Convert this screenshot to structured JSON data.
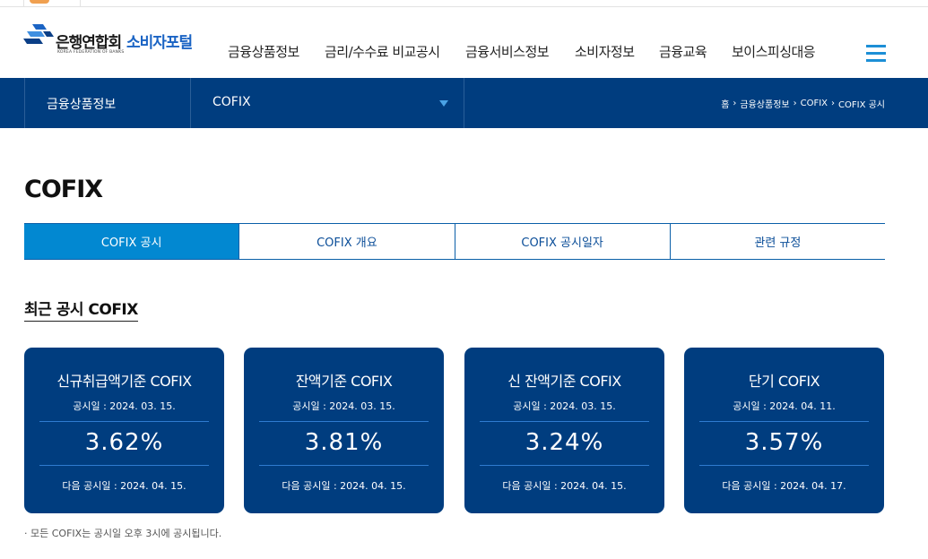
{
  "logo": {
    "name": "은행연합회",
    "english": "KOREA FEDERATION OF BANKS",
    "portal": "소비자포털"
  },
  "nav": {
    "items": [
      "금융상품정보",
      "금리/수수료 비교공시",
      "금융서비스정보",
      "소비자정보",
      "금융교육",
      "보이스피싱대응"
    ]
  },
  "subbar": {
    "depth1": "금융상품정보",
    "depth2": "COFIX",
    "breadcrumb": [
      "홈",
      "금융상품정보",
      "COFIX",
      "COFIX 공시"
    ]
  },
  "page": {
    "title": "COFIX",
    "section_title": "최근 공시 COFIX",
    "footnote": "· 모든 COFIX는 공시일 오후 3시에 공시됩니다."
  },
  "tabs": [
    {
      "label": "COFIX 공시",
      "active": true
    },
    {
      "label": "COFIX 개요",
      "active": false
    },
    {
      "label": "COFIX 공시일자",
      "active": false
    },
    {
      "label": "관련 규정",
      "active": false
    }
  ],
  "cards": [
    {
      "name": "신규취급액기준 COFIX",
      "date": "공시일 : 2024. 03. 15.",
      "rate": "3.62%",
      "next": "다음 공시일 : 2024. 04. 15."
    },
    {
      "name": "잔액기준 COFIX",
      "date": "공시일 : 2024. 03. 15.",
      "rate": "3.81%",
      "next": "다음 공시일 : 2024. 04. 15."
    },
    {
      "name": "신 잔액기준 COFIX",
      "date": "공시일 : 2024. 03. 15.",
      "rate": "3.24%",
      "next": "다음 공시일 : 2024. 04. 15."
    },
    {
      "name": "단기 COFIX",
      "date": "공시일 : 2024. 04. 11.",
      "rate": "3.57%",
      "next": "다음 공시일 : 2024. 04. 17."
    }
  ],
  "icons": {
    "logo": "bank-federation-logo-icon",
    "menu": "hamburger-menu-icon",
    "dropdown": "caret-down-icon",
    "breadcrumb_separator": "chevron-right-icon"
  },
  "colors": {
    "navy": "#003d7f",
    "tab_active": "#0288d1",
    "portal_blue": "#1b64c4",
    "hamburger": "#1c8fd6"
  }
}
